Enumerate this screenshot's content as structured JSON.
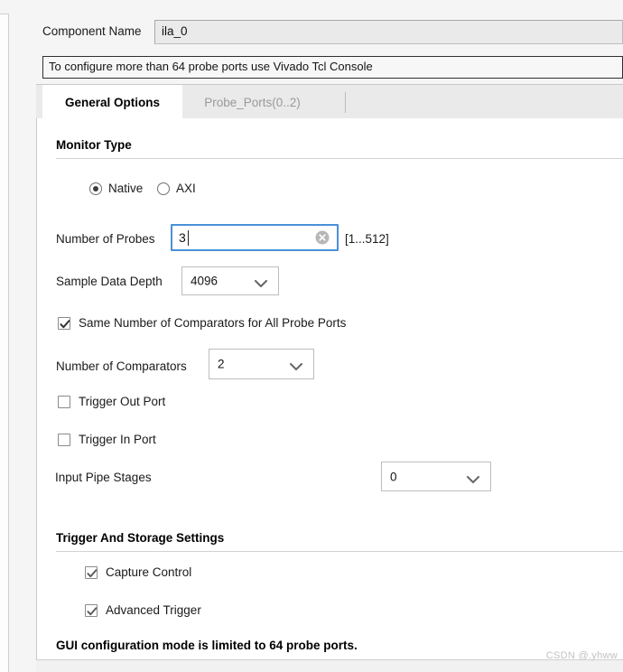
{
  "window": {
    "component_name_label": "Component Name",
    "component_name_value": "ila_0",
    "info_banner": "To configure more than 64 probe ports use Vivado Tcl Console",
    "bottom_note": "GUI configuration mode is limited to 64 probe ports.",
    "watermark": "CSDN @.yhww",
    "accent_focus_color": "#4a90d9"
  },
  "tabs": [
    {
      "label": "General Options",
      "active": true
    },
    {
      "label": "Probe_Ports(0..2)",
      "active": false
    }
  ],
  "monitor_type": {
    "heading": "Monitor Type",
    "options": [
      {
        "label": "Native",
        "selected": true
      },
      {
        "label": "AXI",
        "selected": false
      }
    ]
  },
  "general": {
    "number_of_probes": {
      "label": "Number of Probes",
      "value": "3",
      "range_hint": "[1...512]",
      "clear_icon": "clear-circle-icon"
    },
    "sample_data_depth": {
      "label": "Sample Data Depth",
      "value": "4096",
      "arrow_icon": "chevron-down-icon"
    },
    "same_comparators": {
      "label": "Same Number of Comparators for All Probe Ports",
      "checked": true
    },
    "number_of_comparators": {
      "label": "Number of Comparators",
      "value": "2",
      "arrow_icon": "chevron-down-icon"
    },
    "trigger_out_port": {
      "label": "Trigger Out Port",
      "checked": false
    },
    "trigger_in_port": {
      "label": "Trigger In Port",
      "checked": false
    },
    "input_pipe_stages": {
      "label": "Input Pipe Stages",
      "value": "0",
      "arrow_icon": "chevron-down-icon"
    }
  },
  "trigger_storage": {
    "heading": "Trigger And Storage Settings",
    "capture_control": {
      "label": "Capture Control",
      "checked": true
    },
    "advanced_trigger": {
      "label": "Advanced Trigger",
      "checked": true
    }
  }
}
